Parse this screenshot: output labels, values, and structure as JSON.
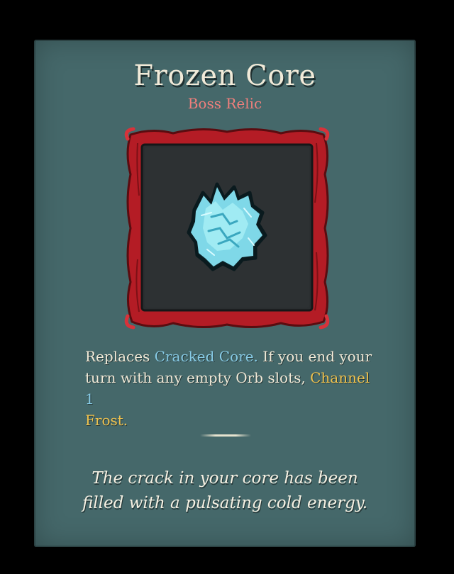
{
  "relic": {
    "name": "Frozen Core",
    "rarity": "Boss Relic",
    "icon": "frozen-core-ice-crystal-icon",
    "description": {
      "part1": "Replaces ",
      "keyword_replaced": "Cracked Core.",
      "part2": " If you end your turn with any empty Orb slots, ",
      "keyword_channel": "Channel",
      "number": " 1",
      "keyword_orb": "Frost."
    },
    "flavor_line1": "The crack in your core has been",
    "flavor_line2": "filled with a pulsating cold energy."
  },
  "colors": {
    "panel": "#45686a",
    "title": "#f1ead8",
    "rarity": "#ef7f7c",
    "keyword_blue": "#87cbe6",
    "keyword_gold": "#efc24f",
    "frame_red": "#c8202a",
    "ice": "#8fe3f0"
  }
}
